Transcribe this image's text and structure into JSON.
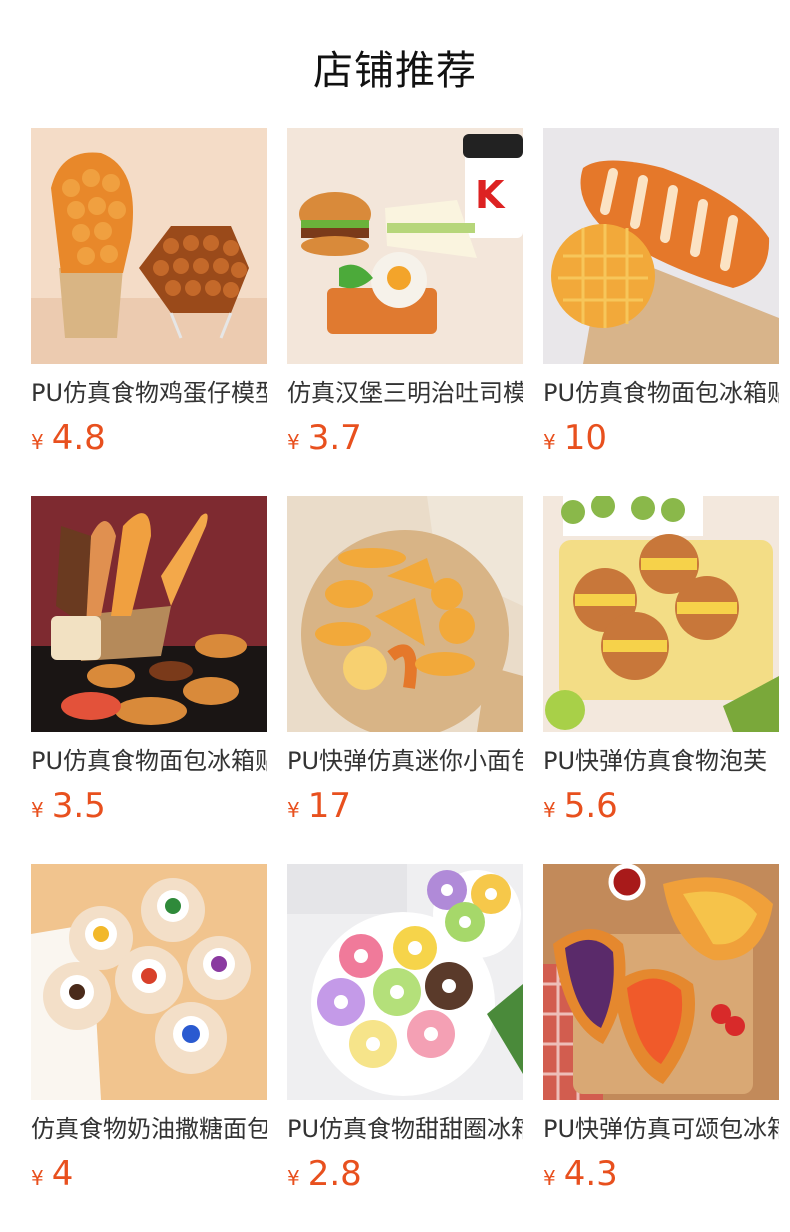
{
  "section": {
    "title": "店铺推荐"
  },
  "products": [
    {
      "name": "PU仿真食物鸡蛋仔模型",
      "currency": "¥",
      "price": "4.8",
      "image": "egg-waffle-photo"
    },
    {
      "name": "仿真汉堡三明治吐司模型",
      "currency": "¥",
      "price": "3.7",
      "image": "burger-sandwich-photo"
    },
    {
      "name": "PU仿真食物面包冰箱贴",
      "currency": "¥",
      "price": "10",
      "image": "baguette-bread-photo"
    },
    {
      "name": "PU仿真食物面包冰箱贴",
      "currency": "¥",
      "price": "3.5",
      "image": "bread-basket-photo"
    },
    {
      "name": "PU快弹仿真迷你小面包",
      "currency": "¥",
      "price": "17",
      "image": "mini-breads-photo"
    },
    {
      "name": "PU快弹仿真食物泡芙",
      "currency": "¥",
      "price": "5.6",
      "image": "cream-puff-photo"
    },
    {
      "name": "仿真食物奶油撒糖面包",
      "currency": "¥",
      "price": "4",
      "image": "swirl-cake-photo"
    },
    {
      "name": "PU仿真食物甜甜圈冰箱贴",
      "currency": "¥",
      "price": "2.8",
      "image": "donut-plate-photo"
    },
    {
      "name": "PU快弹仿真可颂包冰箱贴",
      "currency": "¥",
      "price": "4.3",
      "image": "croissant-photo"
    }
  ]
}
